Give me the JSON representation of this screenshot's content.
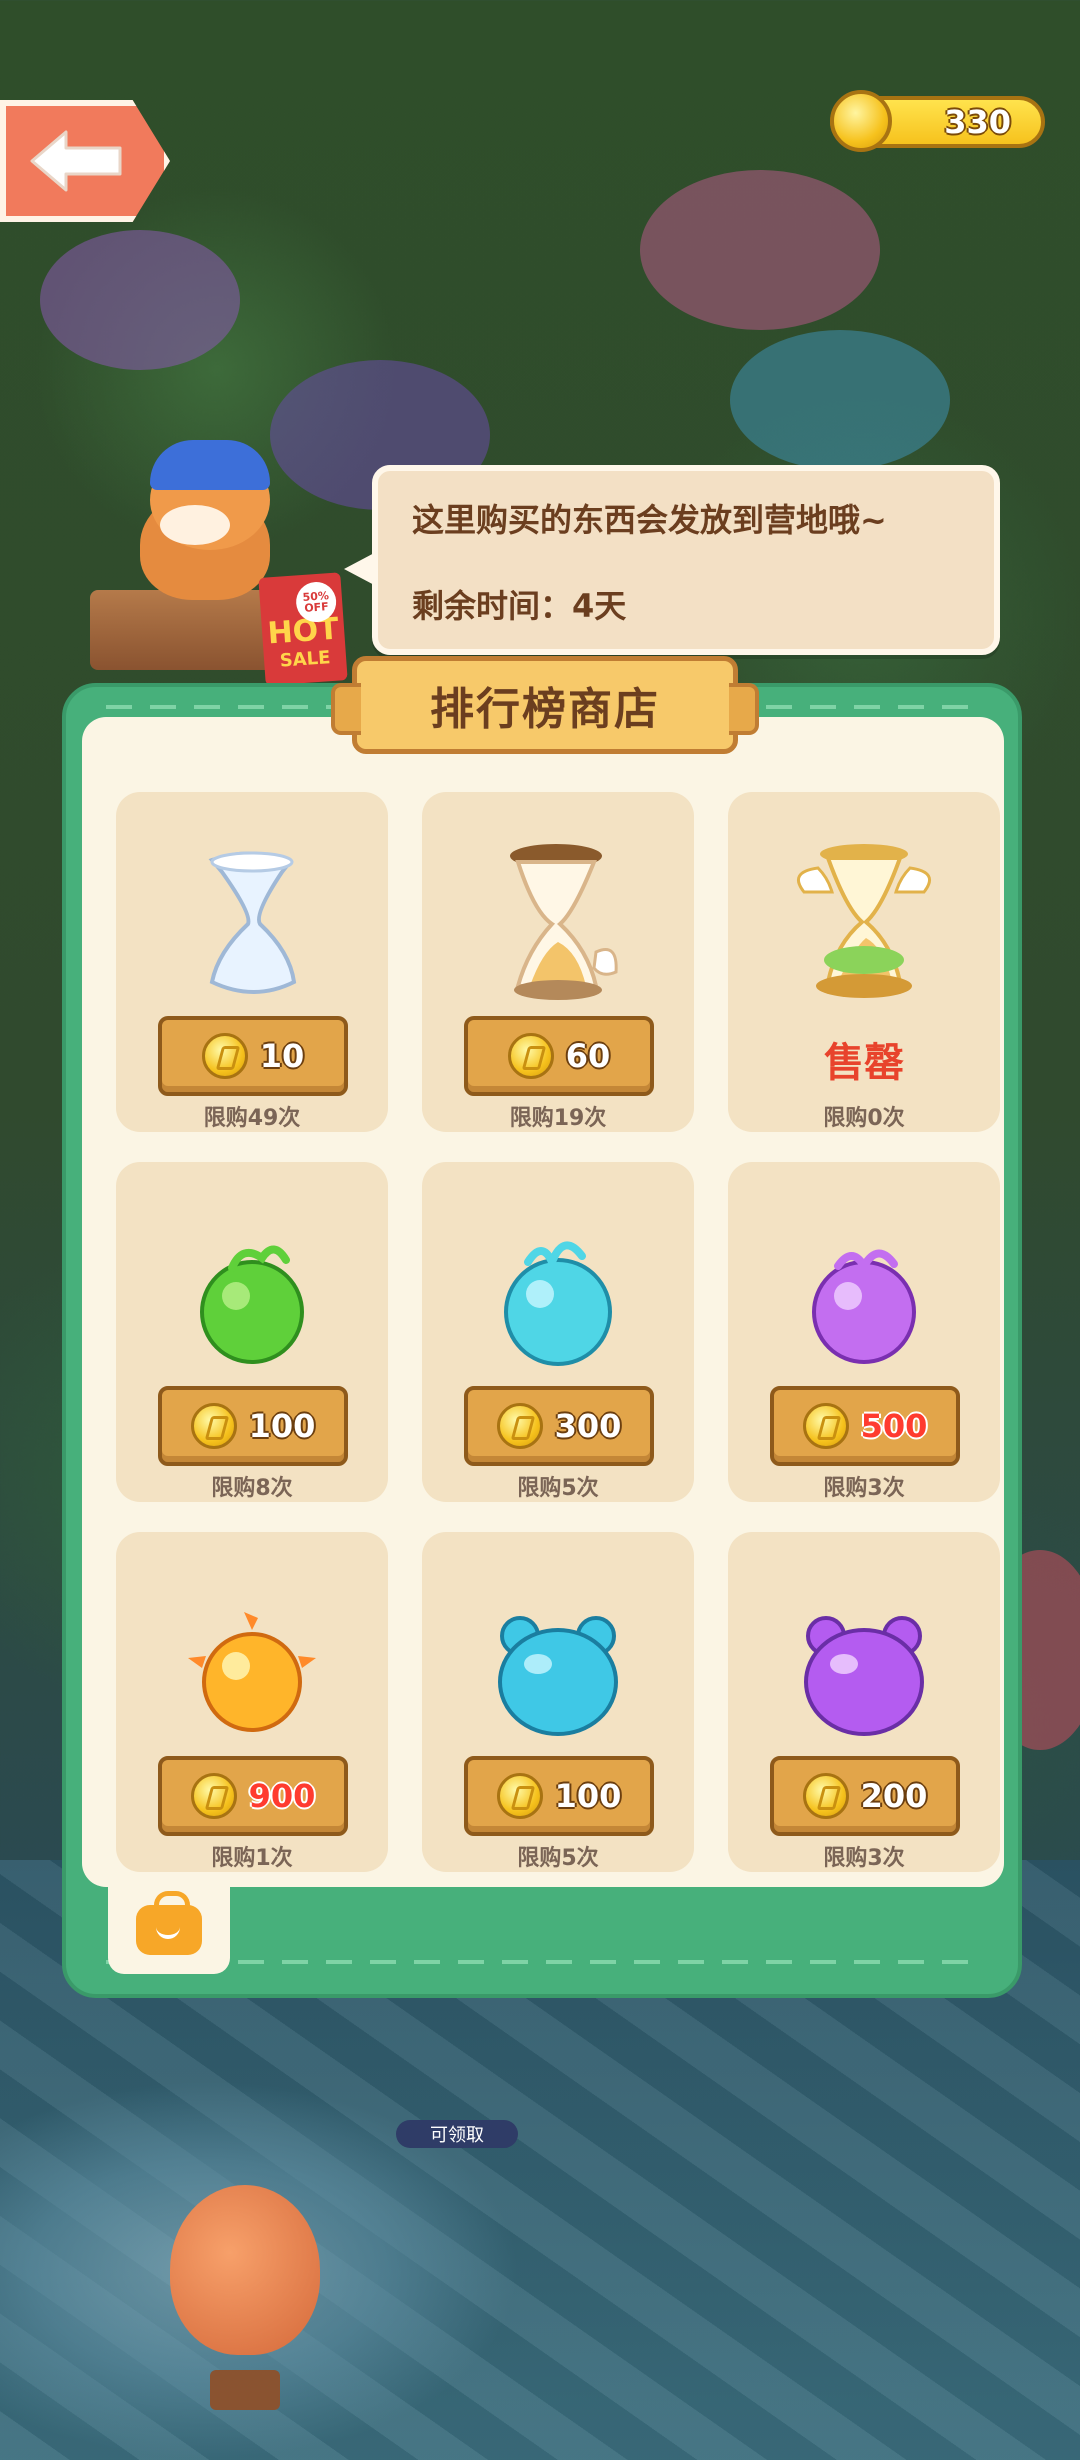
{
  "header": {
    "back_label": "",
    "coins": "330"
  },
  "hud": {
    "back_icon": "arrow-left-icon",
    "coin_icon": "gold-coin-icon"
  },
  "shop": {
    "title": "排行榜商店",
    "hot_sign": {
      "off": "50%",
      "off2": "OFF",
      "hot": "HOT",
      "sale": "SALE"
    },
    "bubble": {
      "line1": "这里购买的东西会发放到营地哦~",
      "line2": "剩余时间：4天"
    },
    "items": [
      {
        "icon": "clear-hourglass-icon",
        "price": "10",
        "limit": "限购49次",
        "red": false,
        "sold_out": false
      },
      {
        "icon": "sand-hourglass-icon",
        "price": "60",
        "limit": "限购19次",
        "red": false,
        "sold_out": false
      },
      {
        "icon": "winged-hourglass-icon",
        "price": "",
        "limit": "限购0次",
        "red": false,
        "sold_out": true,
        "sold_out_label": "售罄"
      },
      {
        "icon": "green-orb-icon",
        "price": "100",
        "limit": "限购8次",
        "red": false,
        "sold_out": false
      },
      {
        "icon": "cyan-orb-icon",
        "price": "300",
        "limit": "限购5次",
        "red": false,
        "sold_out": false
      },
      {
        "icon": "purple-orb-icon",
        "price": "500",
        "limit": "限购3次",
        "red": true,
        "sold_out": false
      },
      {
        "icon": "golden-orb-icon",
        "price": "900",
        "limit": "限购1次",
        "red": true,
        "sold_out": false
      },
      {
        "icon": "blue-bear-jelly-icon",
        "price": "100",
        "limit": "限购5次",
        "red": false,
        "sold_out": false
      },
      {
        "icon": "purple-bear-jelly-icon",
        "price": "200",
        "limit": "限购3次",
        "red": false,
        "sold_out": false
      }
    ],
    "bag_icon": "shopping-bag-icon"
  },
  "world": {
    "claim_label": "可领取"
  },
  "colors": {
    "panel_green": "#47b07b",
    "panel_cream": "#fbf5e4",
    "card_bg": "#f3e2c3",
    "price_button": "#e2a54a",
    "sold_out_red": "#e8432c",
    "coin_gold": "#f6c21d"
  }
}
